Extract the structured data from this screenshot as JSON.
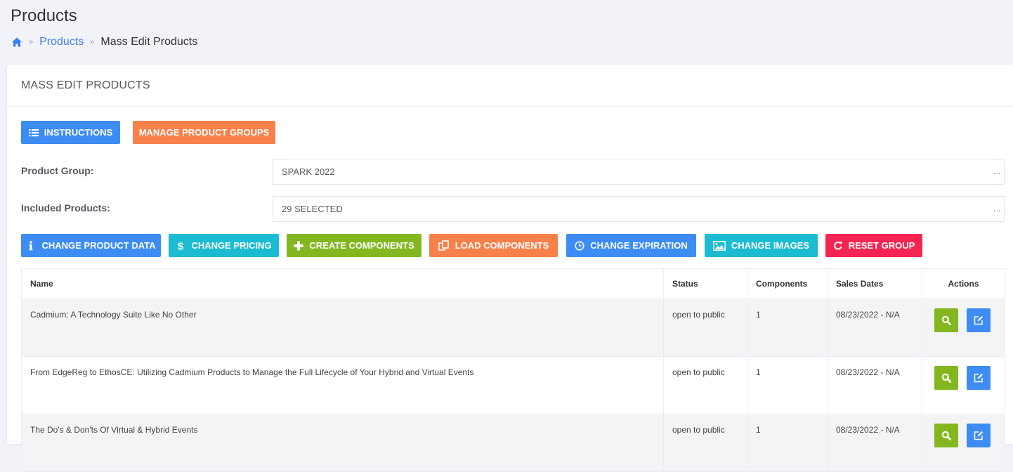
{
  "page": {
    "title": "Products"
  },
  "breadcrumb": {
    "link": "Products",
    "current": "Mass Edit Products",
    "separator": "»"
  },
  "portlet": {
    "title": "MASS EDIT PRODUCTS"
  },
  "toolbar": {
    "instructions": "INSTRUCTIONS",
    "manage_groups": "MANAGE PRODUCT GROUPS"
  },
  "fields": {
    "product_group_label": "Product Group:",
    "product_group_value": "SPARK 2022",
    "included_label": "Included Products:",
    "included_value": "29 SELECTED",
    "ellipsis": "..."
  },
  "actions": {
    "change_product_data": "CHANGE PRODUCT DATA",
    "change_pricing": "CHANGE PRICING",
    "create_components": "CREATE COMPONENTS",
    "load_components": "LOAD COMPONENTS",
    "change_expiration": "CHANGE EXPIRATION",
    "change_images": "CHANGE IMAGES",
    "reset_group": "RESET GROUP"
  },
  "table": {
    "headers": [
      "Name",
      "Status",
      "Components",
      "Sales Dates",
      "Actions"
    ],
    "rows": [
      {
        "name": "Cadmium: A Technology Suite Like No Other",
        "status": "open to public",
        "components": "1",
        "dates": "08/23/2022 - N/A"
      },
      {
        "name": "From EdgeReg to EthosCE: Utilizing Cadmium Products to Manage the Full Lifecycle of Your Hybrid and Virtual Events",
        "status": "open to public",
        "components": "1",
        "dates": "08/23/2022 - N/A"
      },
      {
        "name": "The Do's & Don'ts Of Virtual & Hybrid Events",
        "status": "open to public",
        "components": "1",
        "dates": "08/23/2022 - N/A"
      }
    ]
  },
  "colors": {
    "primary": "#3d8cf4",
    "warning": "#f8804a",
    "info": "#1bbcd2",
    "success": "#83b71f",
    "danger": "#f42552",
    "link": "#3d7cf4"
  },
  "icons": {
    "breadcrumb_home": "home-icon",
    "instructions": "list-icon",
    "change_product_data": "info-icon",
    "change_pricing": "dollar-icon",
    "create_components": "plus-icon",
    "load_components": "copy-icon",
    "change_expiration": "clock-icon",
    "change_images": "image-icon",
    "reset_group": "refresh-icon",
    "row_view": "search-icon",
    "row_edit": "edit-icon"
  }
}
